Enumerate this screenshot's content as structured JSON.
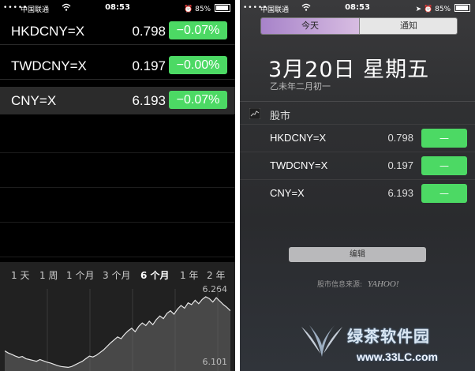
{
  "left": {
    "status": {
      "carrier": "中国联通",
      "time": "08:53",
      "battery": "85%"
    },
    "stocks": [
      {
        "symbol": "HKDCNY=X",
        "price": "0.798",
        "change": "−0.07%"
      },
      {
        "symbol": "TWDCNY=X",
        "price": "0.197",
        "change": "−0.00%"
      },
      {
        "symbol": "CNY=X",
        "price": "6.193",
        "change": "−0.07%"
      }
    ],
    "range_tabs": [
      "1 天",
      "1 周",
      "1 个月",
      "3 个月",
      "6 个月",
      "1 年",
      "2 年"
    ],
    "active_tab": "6 个月",
    "chart_data": {
      "type": "area",
      "title": "",
      "ymax_label": "6.264",
      "ymin_label": "6.101",
      "ylim": [
        6.101,
        6.264
      ],
      "values": [
        6.14,
        6.135,
        6.132,
        6.128,
        6.125,
        6.127,
        6.122,
        6.12,
        6.118,
        6.116,
        6.12,
        6.117,
        6.114,
        6.112,
        6.109,
        6.106,
        6.104,
        6.103,
        6.102,
        6.104,
        6.108,
        6.112,
        6.116,
        6.122,
        6.128,
        6.126,
        6.13,
        6.136,
        6.142,
        6.15,
        6.158,
        6.165,
        6.172,
        6.168,
        6.178,
        6.186,
        6.192,
        6.184,
        6.196,
        6.204,
        6.198,
        6.208,
        6.2,
        6.212,
        6.22,
        6.214,
        6.226,
        6.232,
        6.224,
        6.236,
        6.244,
        6.238,
        6.25,
        6.246,
        6.256,
        6.248,
        6.258,
        6.264,
        6.26,
        6.252,
        6.262,
        6.254,
        6.246,
        6.24,
        6.232
      ]
    }
  },
  "right": {
    "status": {
      "carrier": "中国联通",
      "time": "08:53",
      "battery": "85%"
    },
    "segments": [
      "今天",
      "通知"
    ],
    "date": "3月20日 星期五",
    "lunar": "乙未年二月初一",
    "section_title": "股市",
    "stocks": [
      {
        "symbol": "HKDCNY=X",
        "price": "0.798",
        "change": "—"
      },
      {
        "symbol": "TWDCNY=X",
        "price": "0.197",
        "change": "—"
      },
      {
        "symbol": "CNY=X",
        "price": "6.193",
        "change": "—"
      }
    ],
    "edit_label": "编辑",
    "source_label": "股市信息来源:",
    "source_brand": "YAHOO!"
  },
  "watermark": {
    "title": "绿茶软件园",
    "url": "www.33LC.com"
  },
  "colors": {
    "positive": "#4cd964",
    "segment_active": "#b48fd0"
  }
}
